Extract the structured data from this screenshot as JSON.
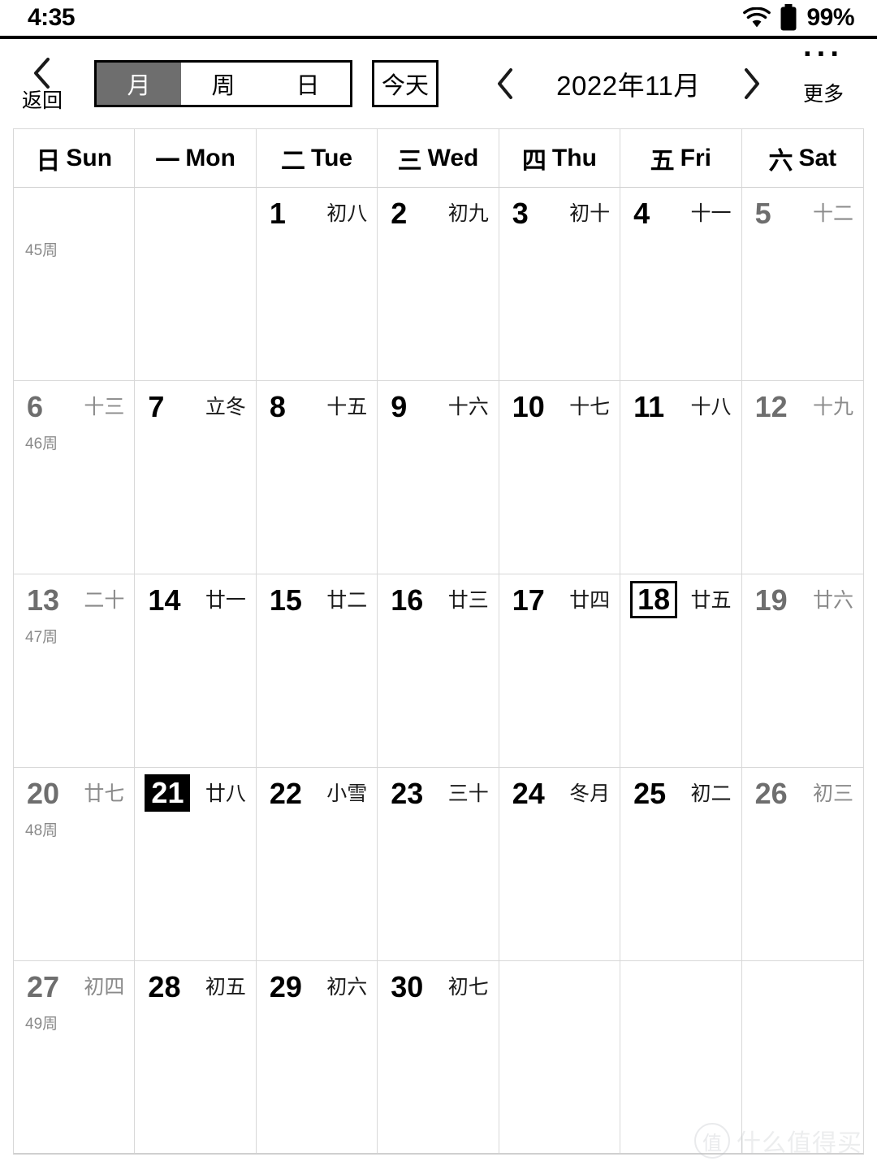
{
  "status_bar": {
    "time": "4:35",
    "battery_percent": "99%",
    "wifi_icon": "wifi-icon",
    "battery_icon": "battery-full-icon"
  },
  "toolbar": {
    "back_label": "返回",
    "back_icon": "chevron-left-icon",
    "view_segments": [
      {
        "label": "月",
        "selected": true
      },
      {
        "label": "周",
        "selected": false
      },
      {
        "label": "日",
        "selected": false
      }
    ],
    "today_label": "今天",
    "prev_month_icon": "chevron-left-icon",
    "next_month_icon": "chevron-right-icon",
    "month_label": "2022年11月",
    "more_label": "更多",
    "more_icon": "ellipsis-icon",
    "more_dots": "···"
  },
  "weekdays": [
    {
      "cn": "日",
      "en": "Sun"
    },
    {
      "cn": "一",
      "en": "Mon"
    },
    {
      "cn": "二",
      "en": "Tue"
    },
    {
      "cn": "三",
      "en": "Wed"
    },
    {
      "cn": "四",
      "en": "Thu"
    },
    {
      "cn": "五",
      "en": "Fri"
    },
    {
      "cn": "六",
      "en": "Sat"
    }
  ],
  "weeks": [
    {
      "week_no": "45周",
      "days": [
        {
          "num": "",
          "lunar": "",
          "weekend": true,
          "today": false,
          "selected": false
        },
        {
          "num": "",
          "lunar": "",
          "weekend": false,
          "today": false,
          "selected": false
        },
        {
          "num": "1",
          "lunar": "初八",
          "weekend": false,
          "today": false,
          "selected": false
        },
        {
          "num": "2",
          "lunar": "初九",
          "weekend": false,
          "today": false,
          "selected": false
        },
        {
          "num": "3",
          "lunar": "初十",
          "weekend": false,
          "today": false,
          "selected": false
        },
        {
          "num": "4",
          "lunar": "十一",
          "weekend": false,
          "today": false,
          "selected": false
        },
        {
          "num": "5",
          "lunar": "十二",
          "weekend": true,
          "today": false,
          "selected": false
        }
      ]
    },
    {
      "week_no": "46周",
      "days": [
        {
          "num": "6",
          "lunar": "十三",
          "weekend": true,
          "today": false,
          "selected": false
        },
        {
          "num": "7",
          "lunar": "立冬",
          "weekend": false,
          "today": false,
          "selected": false
        },
        {
          "num": "8",
          "lunar": "十五",
          "weekend": false,
          "today": false,
          "selected": false
        },
        {
          "num": "9",
          "lunar": "十六",
          "weekend": false,
          "today": false,
          "selected": false
        },
        {
          "num": "10",
          "lunar": "十七",
          "weekend": false,
          "today": false,
          "selected": false
        },
        {
          "num": "11",
          "lunar": "十八",
          "weekend": false,
          "today": false,
          "selected": false
        },
        {
          "num": "12",
          "lunar": "十九",
          "weekend": true,
          "today": false,
          "selected": false
        }
      ]
    },
    {
      "week_no": "47周",
      "days": [
        {
          "num": "13",
          "lunar": "二十",
          "weekend": true,
          "today": false,
          "selected": false
        },
        {
          "num": "14",
          "lunar": "廿一",
          "weekend": false,
          "today": false,
          "selected": false
        },
        {
          "num": "15",
          "lunar": "廿二",
          "weekend": false,
          "today": false,
          "selected": false
        },
        {
          "num": "16",
          "lunar": "廿三",
          "weekend": false,
          "today": false,
          "selected": false
        },
        {
          "num": "17",
          "lunar": "廿四",
          "weekend": false,
          "today": false,
          "selected": false
        },
        {
          "num": "18",
          "lunar": "廿五",
          "weekend": false,
          "today": true,
          "selected": false
        },
        {
          "num": "19",
          "lunar": "廿六",
          "weekend": true,
          "today": false,
          "selected": false
        }
      ]
    },
    {
      "week_no": "48周",
      "days": [
        {
          "num": "20",
          "lunar": "廿七",
          "weekend": true,
          "today": false,
          "selected": false
        },
        {
          "num": "21",
          "lunar": "廿八",
          "weekend": false,
          "today": false,
          "selected": true
        },
        {
          "num": "22",
          "lunar": "小雪",
          "weekend": false,
          "today": false,
          "selected": false
        },
        {
          "num": "23",
          "lunar": "三十",
          "weekend": false,
          "today": false,
          "selected": false
        },
        {
          "num": "24",
          "lunar": "冬月",
          "weekend": false,
          "today": false,
          "selected": false
        },
        {
          "num": "25",
          "lunar": "初二",
          "weekend": false,
          "today": false,
          "selected": false
        },
        {
          "num": "26",
          "lunar": "初三",
          "weekend": true,
          "today": false,
          "selected": false
        }
      ]
    },
    {
      "week_no": "49周",
      "days": [
        {
          "num": "27",
          "lunar": "初四",
          "weekend": true,
          "today": false,
          "selected": false
        },
        {
          "num": "28",
          "lunar": "初五",
          "weekend": false,
          "today": false,
          "selected": false
        },
        {
          "num": "29",
          "lunar": "初六",
          "weekend": false,
          "today": false,
          "selected": false
        },
        {
          "num": "30",
          "lunar": "初七",
          "weekend": false,
          "today": false,
          "selected": false
        },
        {
          "num": "",
          "lunar": "",
          "weekend": false,
          "today": false,
          "selected": false
        },
        {
          "num": "",
          "lunar": "",
          "weekend": false,
          "today": false,
          "selected": false
        },
        {
          "num": "",
          "lunar": "",
          "weekend": true,
          "today": false,
          "selected": false
        }
      ]
    }
  ],
  "watermark": {
    "badge": "值",
    "text": "什么值得买"
  },
  "colors": {
    "selected_bg": "#000000",
    "segment_active_bg": "#6e6e6e",
    "weekend_text": "#6e6e6e",
    "grid_line": "#d8d8d8"
  }
}
